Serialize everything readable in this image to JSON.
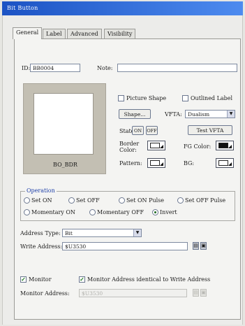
{
  "window": {
    "title": "Bit Button"
  },
  "tabs": [
    "General",
    "Label",
    "Advanced",
    "Visibility"
  ],
  "general": {
    "id_label": "ID:",
    "id_value": "BB0004",
    "note_label": "Note:",
    "note_value": "",
    "preview_label": "BO_BDR",
    "picture_shape_label": "Picture Shape",
    "outlined_label_label": "Outlined Label",
    "shape_button": "Shape...",
    "vfta_label": "VFTA:",
    "vfta_value": "Dualism",
    "state_label": "State:",
    "state_on": "ON",
    "state_off": "OFF",
    "test_vfta_button": "Test VFTA",
    "border_color_label": "Border Color:",
    "fg_color_label": "FG Color:",
    "pattern_label": "Pattern:",
    "bg_label": "BG:"
  },
  "operation": {
    "title": "Operation",
    "options": [
      "Set ON",
      "Set OFF",
      "Set ON Pulse",
      "Set OFF Pulse",
      "Momentary ON",
      "Momentary OFF",
      "Invert"
    ],
    "selected": "Invert"
  },
  "address": {
    "type_label": "Address Type:",
    "type_value": "Bit",
    "write_label": "Write Address:",
    "write_value": "$U3530"
  },
  "monitor": {
    "monitor_label": "Monitor",
    "monitor_checked": true,
    "identical_label": "Monitor Address identical to Write Address",
    "identical_checked": true,
    "address_label": "Monitor Address:",
    "address_value": "$U3530"
  }
}
